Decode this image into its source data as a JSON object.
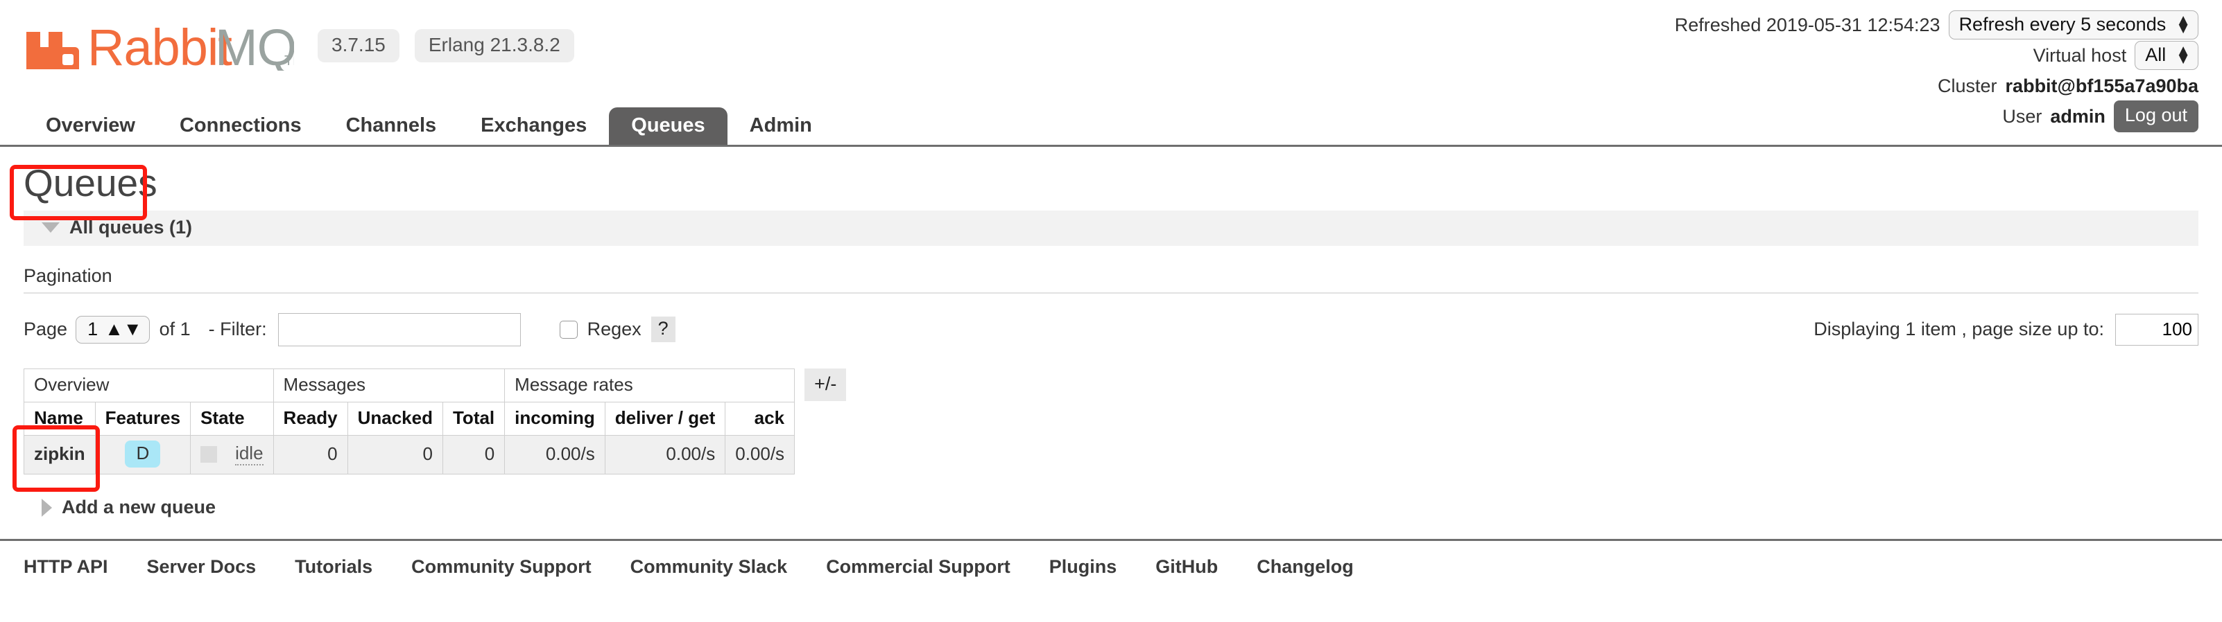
{
  "brand": {
    "name": "RabbitMQ",
    "trademark": "TM",
    "version": "3.7.15",
    "erlang_version": "Erlang 21.3.8.2",
    "logo_color": "#f26d3d",
    "logo_text_gray": "#9aa3a0"
  },
  "header": {
    "refreshed_label": "Refreshed 2019-05-31 12:54:23",
    "refresh_interval": "Refresh every 5 seconds",
    "vhost_label": "Virtual host",
    "vhost_value": "All",
    "cluster_label": "Cluster",
    "cluster_value": "rabbit@bf155a7a90ba",
    "user_label": "User",
    "user_value": "admin",
    "logout_label": "Log out"
  },
  "tabs": [
    {
      "label": "Overview",
      "active": false
    },
    {
      "label": "Connections",
      "active": false
    },
    {
      "label": "Channels",
      "active": false
    },
    {
      "label": "Exchanges",
      "active": false
    },
    {
      "label": "Queues",
      "active": true
    },
    {
      "label": "Admin",
      "active": false
    }
  ],
  "page": {
    "title": "Queues",
    "section_label": "All queues (1)"
  },
  "pagination": {
    "heading": "Pagination",
    "page_label": "Page",
    "page_value": "1",
    "of_label": "of 1",
    "filter_label": "- Filter:",
    "filter_value": "",
    "filter_placeholder": "",
    "regex_label": "Regex",
    "help_label": "?",
    "displaying_label": "Displaying 1 item , page size up to:",
    "page_size_value": "100"
  },
  "table": {
    "group_headers": [
      {
        "label": "Overview",
        "colspan": 3
      },
      {
        "label": "Messages",
        "colspan": 3
      },
      {
        "label": "Message rates",
        "colspan": 3
      }
    ],
    "columns": [
      {
        "label": "Name",
        "align": "left"
      },
      {
        "label": "Features",
        "align": "center"
      },
      {
        "label": "State",
        "align": "left"
      },
      {
        "label": "Ready",
        "align": "right"
      },
      {
        "label": "Unacked",
        "align": "right"
      },
      {
        "label": "Total",
        "align": "right"
      },
      {
        "label": "incoming",
        "align": "right"
      },
      {
        "label": "deliver / get",
        "align": "right"
      },
      {
        "label": "ack",
        "align": "right"
      }
    ],
    "rows": [
      {
        "name": "zipkin",
        "feature_badge": "D",
        "state": "idle",
        "ready": "0",
        "unacked": "0",
        "total": "0",
        "incoming": "0.00/s",
        "deliver_get": "0.00/s",
        "ack": "0.00/s"
      }
    ],
    "toggle_columns_label": "+/-"
  },
  "add_queue": {
    "label": "Add a new queue"
  },
  "footer": {
    "links": [
      "HTTP API",
      "Server Docs",
      "Tutorials",
      "Community Support",
      "Community Slack",
      "Commercial Support",
      "Plugins",
      "GitHub",
      "Changelog"
    ]
  },
  "annotations": {
    "highlight_color": "#fb1a10",
    "boxes": [
      {
        "target": "page-title"
      },
      {
        "target": "queue-name-column"
      }
    ]
  }
}
